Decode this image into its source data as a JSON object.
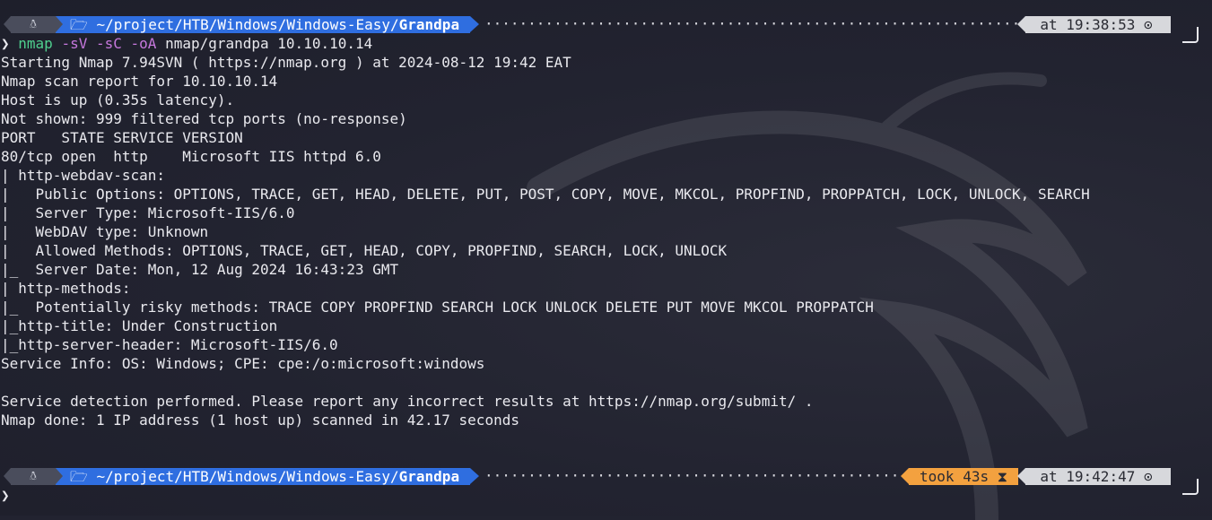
{
  "prompt": {
    "os_icon": "linux-tux-icon",
    "folder_icon": "folder-icon",
    "path": "~/project/HTB/Windows/Windows-Easy/",
    "dir": "Grandpa",
    "first_time": "at 19:38:53 ⊙",
    "second_took": "took 43s ⧗",
    "second_time": "at 19:42:47 ⊙",
    "symbol": "❯",
    "colors": {
      "dir_bg": "#2f6ee0",
      "time_bg": "#d7d8dc",
      "took_bg": "#f3a13f",
      "cmd_green": "#4fd08e",
      "flag_purple": "#c678dd"
    }
  },
  "command": {
    "name": "nmap",
    "flags": "-sV -sC -oA",
    "args": "nmap/grandpa 10.10.10.14"
  },
  "output": [
    "Starting Nmap 7.94SVN ( https://nmap.org ) at 2024-08-12 19:42 EAT",
    "Nmap scan report for 10.10.10.14",
    "Host is up (0.35s latency).",
    "Not shown: 999 filtered tcp ports (no-response)",
    "PORT   STATE SERVICE VERSION",
    "80/tcp open  http    Microsoft IIS httpd 6.0",
    "| http-webdav-scan:",
    "|   Public Options: OPTIONS, TRACE, GET, HEAD, DELETE, PUT, POST, COPY, MOVE, MKCOL, PROPFIND, PROPPATCH, LOCK, UNLOCK, SEARCH",
    "|   Server Type: Microsoft-IIS/6.0",
    "|   WebDAV type: Unknown",
    "|   Allowed Methods: OPTIONS, TRACE, GET, HEAD, COPY, PROPFIND, SEARCH, LOCK, UNLOCK",
    "|_  Server Date: Mon, 12 Aug 2024 16:43:23 GMT",
    "| http-methods:",
    "|_  Potentially risky methods: TRACE COPY PROPFIND SEARCH LOCK UNLOCK DELETE PUT MOVE MKCOL PROPPATCH",
    "|_http-title: Under Construction",
    "|_http-server-header: Microsoft-IIS/6.0",
    "Service Info: OS: Windows; CPE: cpe:/o:microsoft:windows",
    "",
    "Service detection performed. Please report any incorrect results at https://nmap.org/submit/ .",
    "Nmap done: 1 IP address (1 host up) scanned in 42.17 seconds"
  ]
}
